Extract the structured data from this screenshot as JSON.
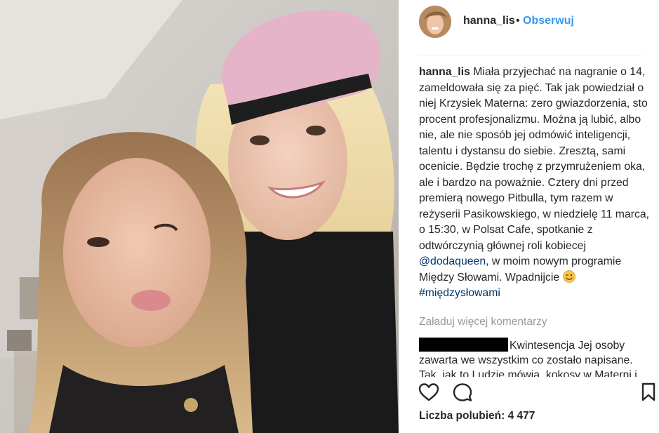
{
  "post": {
    "username": "hanna_lis",
    "separator": "•",
    "follow_label": "Obserwuj",
    "caption_username": "hanna_lis",
    "caption_text_1": "Miała przyjechać na nagranie o 14, zameldowała się za pięć. Tak jak powiedział o niej Krzysiek Materna: zero gwiazdorzenia, sto procent profesjonalizmu. Można ją lubić, albo nie, ale nie sposób jej odmówić inteligencji, talentu i dystansu do siebie. Zresztą, sami ocenicie. Będzie trochę z przymrużeniem oka, ale i bardzo na poważnie. Cztery dni przed premierą nowego Pitbulla, tym razem w reżyserii Pasikowskiego, w niedzielę 11 marca, o 15:30, w Polsat Cafe, spotkanie z odtwórczynią głównej roli kobiecej",
    "mention": "@dodaqueen",
    "caption_text_2": ", w moim nowym programie Między Słowami. Wpadnijcie",
    "hashtag": "#międzysłowami",
    "load_more": "Załaduj więcej komentarzy",
    "comment_text": "Kwintesencja Jej osoby zawarta we wszystkim co zostało napisane. Tak, jak to Ludzie mówią, kokosy w Materni i",
    "likes_label": "Liczba polubień:",
    "likes_count": "4 477"
  },
  "icons": {
    "like": "heart-icon",
    "comment": "comment-icon",
    "save": "bookmark-icon",
    "emoji": "wink-smile-emoji"
  },
  "colors": {
    "link_blue": "#3897f0",
    "mention_blue": "#003569",
    "muted": "#999999",
    "text": "#262626"
  }
}
